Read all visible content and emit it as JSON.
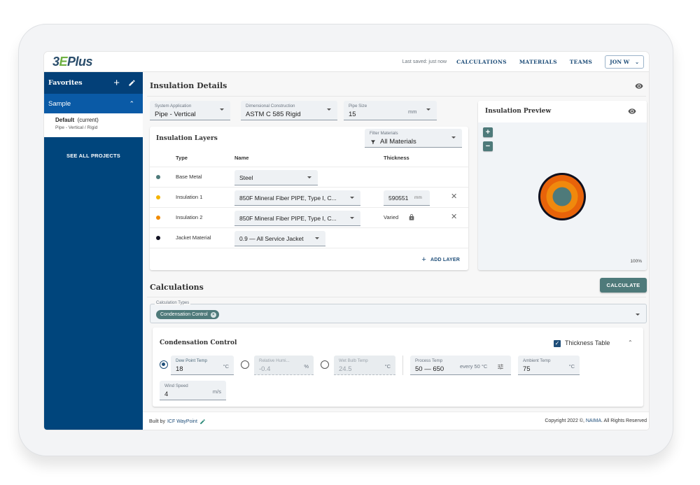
{
  "app": {
    "logo_prefix": "3",
    "logo_e": "E",
    "logo_suffix": "Plus",
    "last_saved": "Last saved: just now",
    "nav": [
      "CALCULATIONS",
      "MATERIALS",
      "TEAMS"
    ],
    "user_label": "JON W"
  },
  "sidebar": {
    "favorites_title": "Favorites",
    "project_name": "Sample",
    "items": [
      {
        "name": "Default",
        "tag": "(current)",
        "subtitle": "Pipe - Vertical / Rigid"
      }
    ],
    "see_all": "SEE ALL PROJECTS"
  },
  "insulation_details": {
    "title": "Insulation Details",
    "system_application": {
      "label": "System Application",
      "value": "Pipe - Vertical"
    },
    "dimensional_construction": {
      "label": "Dimensional Construction",
      "value": "ASTM C 585 Rigid"
    },
    "pipe_size": {
      "label": "Pipe Size",
      "value": "15",
      "unit": "mm"
    }
  },
  "layers": {
    "title": "Insulation Layers",
    "filter": {
      "label": "Filter Materials",
      "value": "All Materials"
    },
    "columns": [
      "Type",
      "Name",
      "Thickness"
    ],
    "rows": [
      {
        "type": "Base Metal",
        "name": "Steel",
        "color": "#4e7a7a",
        "thickness": null,
        "unit": null
      },
      {
        "type": "Insulation 1",
        "name": "850F Mineral Fiber PIPE, Type I, C...",
        "color": "#f5b400",
        "thickness": "590551",
        "unit": "mm"
      },
      {
        "type": "Insulation 2",
        "name": "850F Mineral Fiber PIPE, Type I, C...",
        "color": "#f08a00",
        "thickness": "Varied",
        "unit": null
      },
      {
        "type": "Jacket Material",
        "name": "0.9 — All Service Jacket",
        "color": "#111122",
        "thickness": null,
        "unit": null
      }
    ],
    "add_layer": "ADD LAYER"
  },
  "preview": {
    "title": "Insulation Preview",
    "zoom_level": "100%",
    "ring_colors": {
      "jacket": "#10101e",
      "insulation2": "#e8630a",
      "insulation1": "#f0890d",
      "base": "#4e7a7a"
    }
  },
  "calculations": {
    "title": "Calculations",
    "calculate_button": "CALCULATE",
    "types_label": "Calculation Types",
    "selected_types": [
      "Condensation Control"
    ],
    "condensation": {
      "title": "Condensation Control",
      "thickness_table_label": "Thickness Table",
      "thickness_table_checked": true,
      "dew_point": {
        "label": "Dew Point Temp",
        "value": "18",
        "unit": "°C",
        "selected": true
      },
      "relative_humidity": {
        "label": "Relative Humi...",
        "value": "-0.4",
        "unit": "%",
        "selected": false
      },
      "wet_bulb": {
        "label": "Wet Bulb Temp",
        "value": "24.5",
        "unit": "°C",
        "selected": false
      },
      "process_temp": {
        "label": "Process Temp",
        "value": "50 — 650",
        "step": "every 50 °C"
      },
      "ambient_temp": {
        "label": "Ambient Temp",
        "value": "75",
        "unit": "°C"
      },
      "wind_speed": {
        "label": "Wind Speed",
        "value": "4",
        "unit": "m/s"
      }
    }
  },
  "footer": {
    "built_by": "Built by",
    "built_by_link": "ICF WayPoint",
    "copyright_prefix": "Copyright 2022 ©,",
    "copyright_link": "NAIMA",
    "copyright_suffix": ". All Rights Reserved"
  },
  "colors": {
    "primary": "#00457c",
    "sidebar_active": "#0a5aa6",
    "teal": "#4e7a7a",
    "link": "#1f4e79",
    "logo_green": "#6fb143"
  }
}
